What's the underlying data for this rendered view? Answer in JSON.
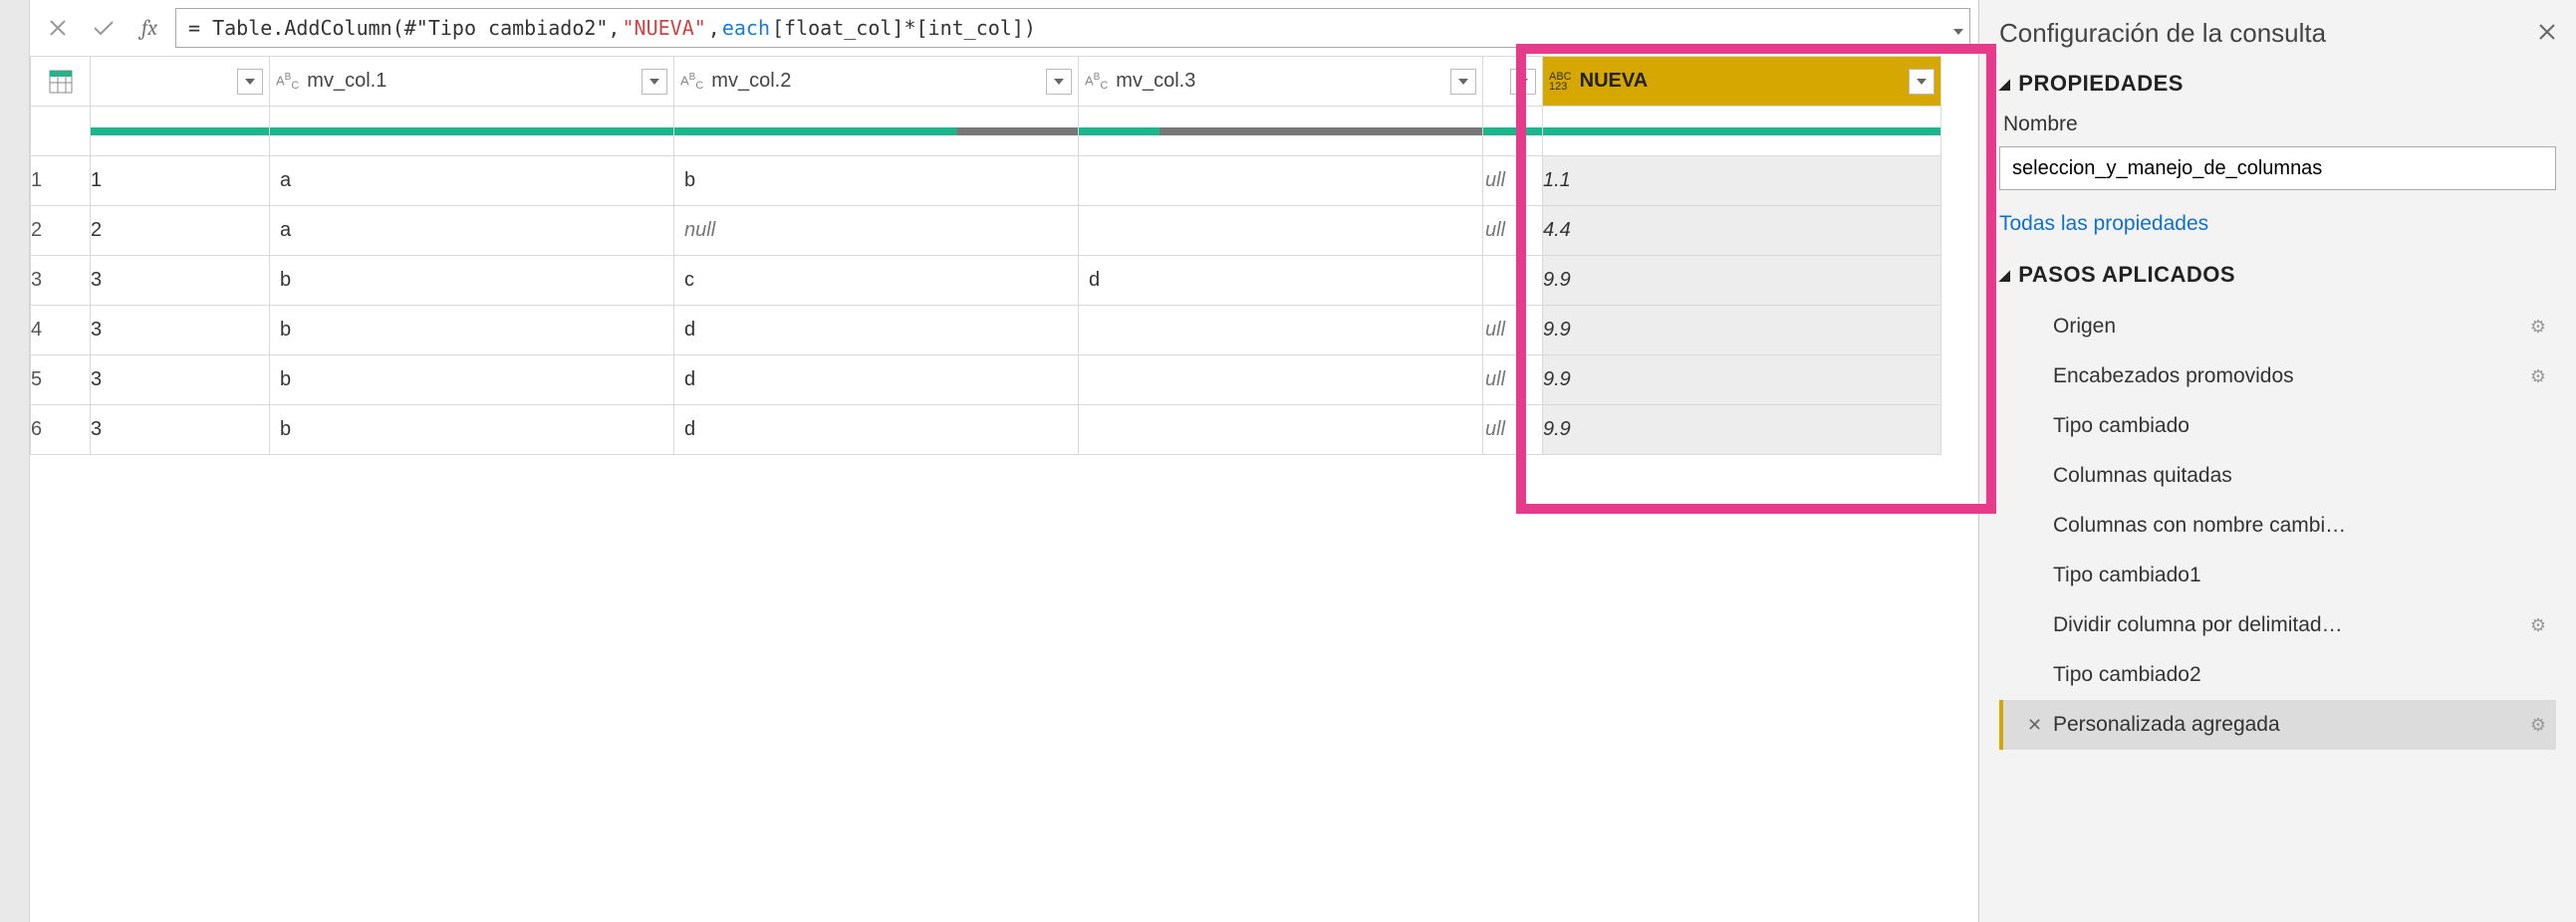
{
  "formula_bar": {
    "prefix": "= Table.AddColumn(#\"Tipo cambiado2\", ",
    "string_lit": "\"NUEVA\"",
    "mid": ", ",
    "each_kw": "each",
    "suffix": " [float_col]*[int_col])"
  },
  "columns": {
    "c0_drop": "▾",
    "c1_type": "AᴮC",
    "c1_name": "mv_col.1",
    "c2_type": "AᴮC",
    "c2_name": "mv_col.2",
    "c3_type": "AᴮC",
    "c3_name": "mv_col.3",
    "c4_type": "ABC 123",
    "c4_name": "NUEVA"
  },
  "rows": [
    {
      "n": "1",
      "id": "1",
      "c1": "a",
      "c2": "b",
      "c3": "",
      "ull": "ull",
      "nueva": "1.1"
    },
    {
      "n": "2",
      "id": "2",
      "c1": "a",
      "c2": "null",
      "c2null": true,
      "c3": "",
      "ull": "ull",
      "nueva": "4.4"
    },
    {
      "n": "3",
      "id": "3",
      "c1": "b",
      "c2": "c",
      "c3": "d",
      "ull": "",
      "nueva": "9.9"
    },
    {
      "n": "4",
      "id": "3",
      "c1": "b",
      "c2": "d",
      "c3": "",
      "ull": "ull",
      "nueva": "9.9"
    },
    {
      "n": "5",
      "id": "3",
      "c1": "b",
      "c2": "d",
      "c3": "",
      "ull": "ull",
      "nueva": "9.9"
    },
    {
      "n": "6",
      "id": "3",
      "c1": "b",
      "c2": "d",
      "c3": "",
      "ull": "ull",
      "nueva": "9.9"
    }
  ],
  "right": {
    "title": "Configuración de la consulta",
    "props_title": "PROPIEDADES",
    "name_label": "Nombre",
    "name_value": "seleccion_y_manejo_de_columnas",
    "all_props": "Todas las propiedades",
    "steps_title": "PASOS APLICADOS",
    "steps": [
      {
        "label": "Origen",
        "gear": true
      },
      {
        "label": "Encabezados promovidos",
        "gear": true
      },
      {
        "label": "Tipo cambiado",
        "gear": false
      },
      {
        "label": "Columnas quitadas",
        "gear": false
      },
      {
        "label": "Columnas con nombre cambi…",
        "gear": false
      },
      {
        "label": "Tipo cambiado1",
        "gear": false
      },
      {
        "label": "Dividir columna por delimitad…",
        "gear": true
      },
      {
        "label": "Tipo cambiado2",
        "gear": false
      },
      {
        "label": "Personalizada agregada",
        "gear": true,
        "selected": true
      }
    ]
  }
}
